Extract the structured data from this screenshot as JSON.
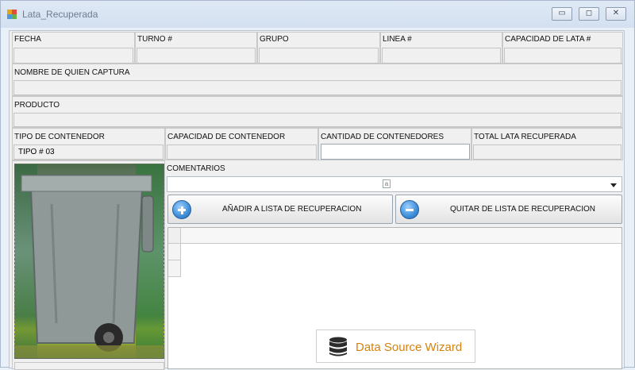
{
  "window": {
    "title": "Lata_Recuperada",
    "minimize": "▭",
    "maximize": "◻",
    "close": "✕"
  },
  "fields": {
    "fecha": {
      "label": "FECHA",
      "value": ""
    },
    "turno": {
      "label": "TURNO #",
      "value": ""
    },
    "grupo": {
      "label": "GRUPO",
      "value": ""
    },
    "linea": {
      "label": "LINEA #",
      "value": ""
    },
    "capacidad_lata": {
      "label": "CAPACIDAD DE LATA #",
      "value": ""
    },
    "nombre": {
      "label": "NOMBRE DE QUIEN CAPTURA",
      "value": ""
    },
    "producto": {
      "label": "PRODUCTO",
      "value": ""
    },
    "tipo_contenedor": {
      "label": "TIPO DE CONTENEDOR",
      "value": "TIPO # 03"
    },
    "capacidad_contenedor": {
      "label": "CAPACIDAD DE CONTENEDOR",
      "value": ""
    },
    "cantidad_contenedores": {
      "label": "CANTIDAD DE CONTENEDORES",
      "value": ""
    },
    "total_lata": {
      "label": "TOTAL LATA RECUPERADA",
      "value": ""
    },
    "comentarios": {
      "label": "COMENTARIOS",
      "value": ""
    }
  },
  "buttons": {
    "add": "AÑADIR A LISTA DE RECUPERACION",
    "remove": "QUITAR DE LISTA DE RECUPERACION"
  },
  "wizard": {
    "label": "Data Source Wizard"
  },
  "icons": {
    "app": "app-icon",
    "add": "plus-circle-icon",
    "remove": "minus-circle-icon",
    "dropdown": "chevron-down-icon",
    "database": "database-icon"
  },
  "colors": {
    "window_bg": "#e9f0f8",
    "form_bg": "#f0f0f0",
    "button_blue": "#3e8fd8",
    "wizard_text": "#d6820f"
  }
}
